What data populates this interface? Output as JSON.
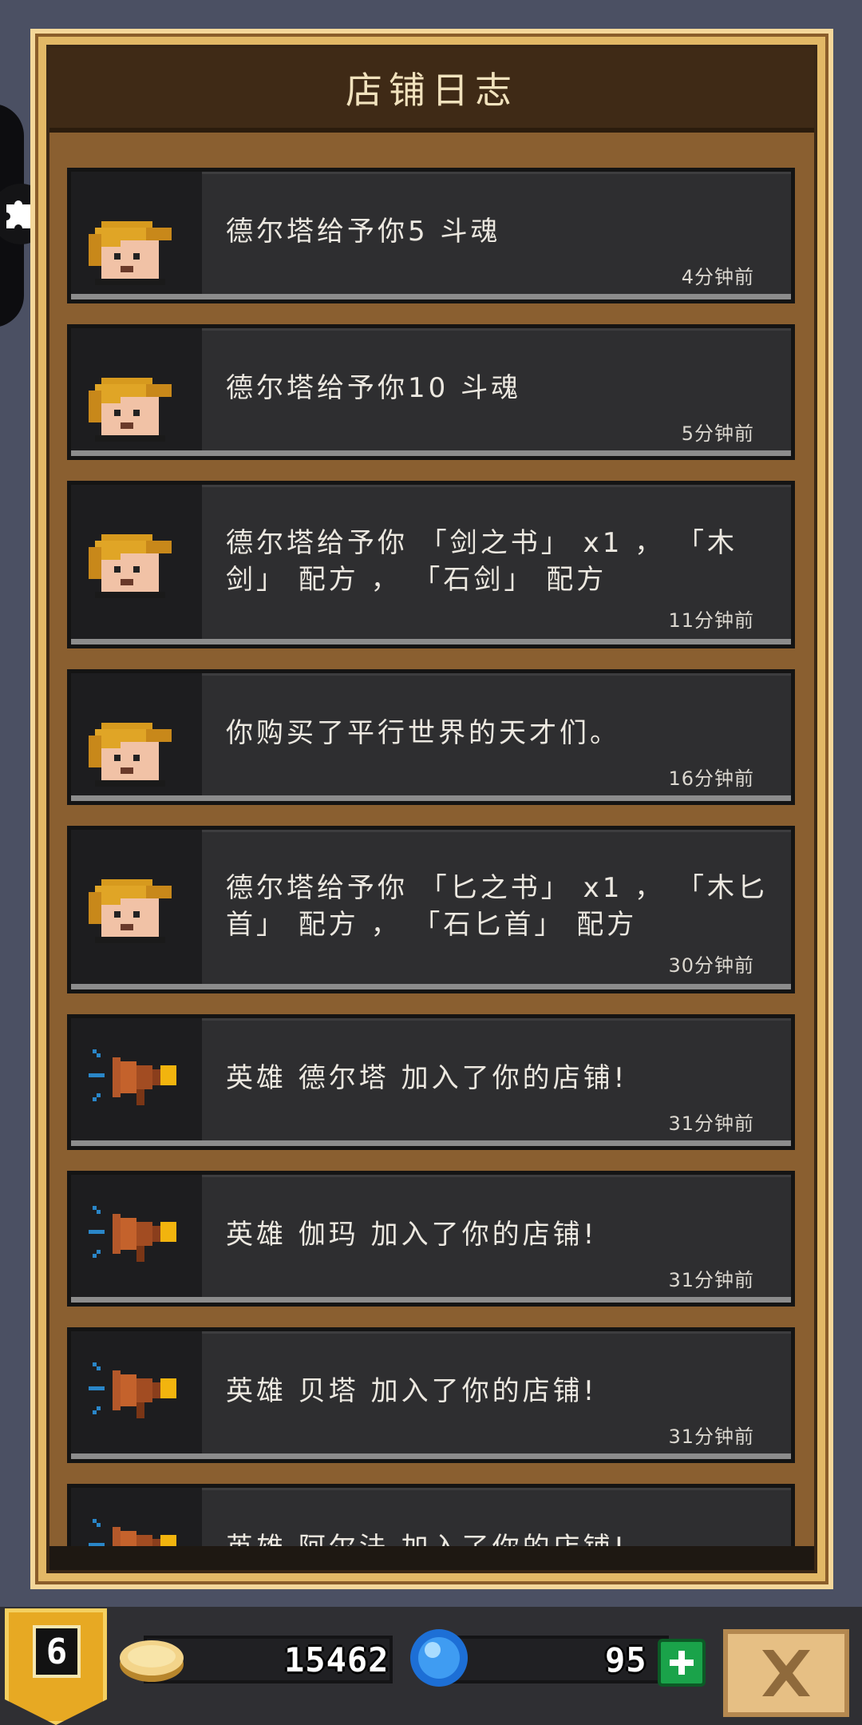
{
  "title": "店铺日志",
  "entries": [
    {
      "icon": "hero-portrait-icon",
      "message": "德尔塔给予你5 斗魂",
      "time": "4分钟前"
    },
    {
      "icon": "hero-portrait-icon",
      "message": "德尔塔给予你10 斗魂",
      "time": "5分钟前"
    },
    {
      "icon": "hero-portrait-icon",
      "message": "德尔塔给予你 「剑之书」 x1 ， 「木剑」 配方 ， 「石剑」 配方",
      "time": "11分钟前"
    },
    {
      "icon": "hero-portrait-icon",
      "message": "你购买了平行世界的天才们。",
      "time": "16分钟前"
    },
    {
      "icon": "hero-portrait-icon",
      "message": "德尔塔给予你 「匕之书」 x1 ， 「木匕首」 配方 ， 「石匕首」 配方",
      "time": "30分钟前"
    },
    {
      "icon": "megaphone-icon",
      "message": "英雄 德尔塔 加入了你的店铺!",
      "time": "31分钟前"
    },
    {
      "icon": "megaphone-icon",
      "message": "英雄 伽玛 加入了你的店铺!",
      "time": "31分钟前"
    },
    {
      "icon": "megaphone-icon",
      "message": "英雄 贝塔 加入了你的店铺!",
      "time": "31分钟前"
    },
    {
      "icon": "megaphone-icon",
      "message": "英雄 阿尔法 加入了你的店铺!",
      "time": ""
    }
  ],
  "footer": {
    "level": "6",
    "gold": "15462",
    "gems": "95"
  },
  "colors": {
    "panel_frame": "#e2b866",
    "list_background": "#8a5f30",
    "card": "#2e2e30",
    "title_bar": "#3f2a16"
  }
}
